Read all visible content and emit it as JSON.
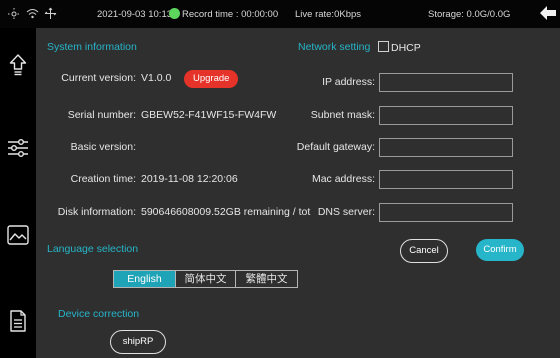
{
  "status_bar": {
    "datetime": "2021-09-03 10:13",
    "record_time": "Record time : 00:00:00",
    "live_rate": "Live rate:0Kbps",
    "storage": "Storage: 0.0G/0.0G"
  },
  "system_information": {
    "title": "System information",
    "current_version_label": "Current version:",
    "current_version": "V1.0.0",
    "upgrade_label": "Upgrade",
    "serial_label": "Serial number:",
    "serial_value": "GBEW52-F41WF15-FW4FW",
    "basic_version_label": "Basic version:",
    "basic_version_value": "",
    "creation_time_label": "Creation time:",
    "creation_time_value": "2019-11-08 12:20:06",
    "disk_label": "Disk information:",
    "disk_value": "590646608009.52GB remaining / tot"
  },
  "network_setting": {
    "title": "Network setting",
    "dhcp_label": "DHCP",
    "dhcp_checked": false,
    "ip_label": "IP address:",
    "ip_value": "",
    "subnet_label": "Subnet mask:",
    "subnet_value": "",
    "gateway_label": "Default gateway:",
    "gateway_value": "",
    "mac_label": "Mac address:",
    "mac_value": "",
    "dns_label": "DNS server:",
    "dns_value": "",
    "cancel_label": "Cancel",
    "confirm_label": "Confirm"
  },
  "language": {
    "title": "Language selection",
    "options": [
      "English",
      "简体中文",
      "繁體中文"
    ],
    "selected": "English"
  },
  "device_correction": {
    "title": "Device correction",
    "button_label": "shipRP"
  },
  "sidebar_icons": [
    "upload-arrow-icon",
    "sliders-icon",
    "image-icon",
    "document-icon"
  ],
  "colors": {
    "accent": "#26b5c9",
    "upgrade": "#e5332a",
    "record_dot": "#5cd65c",
    "panel_bg": "#2f2f2f"
  }
}
